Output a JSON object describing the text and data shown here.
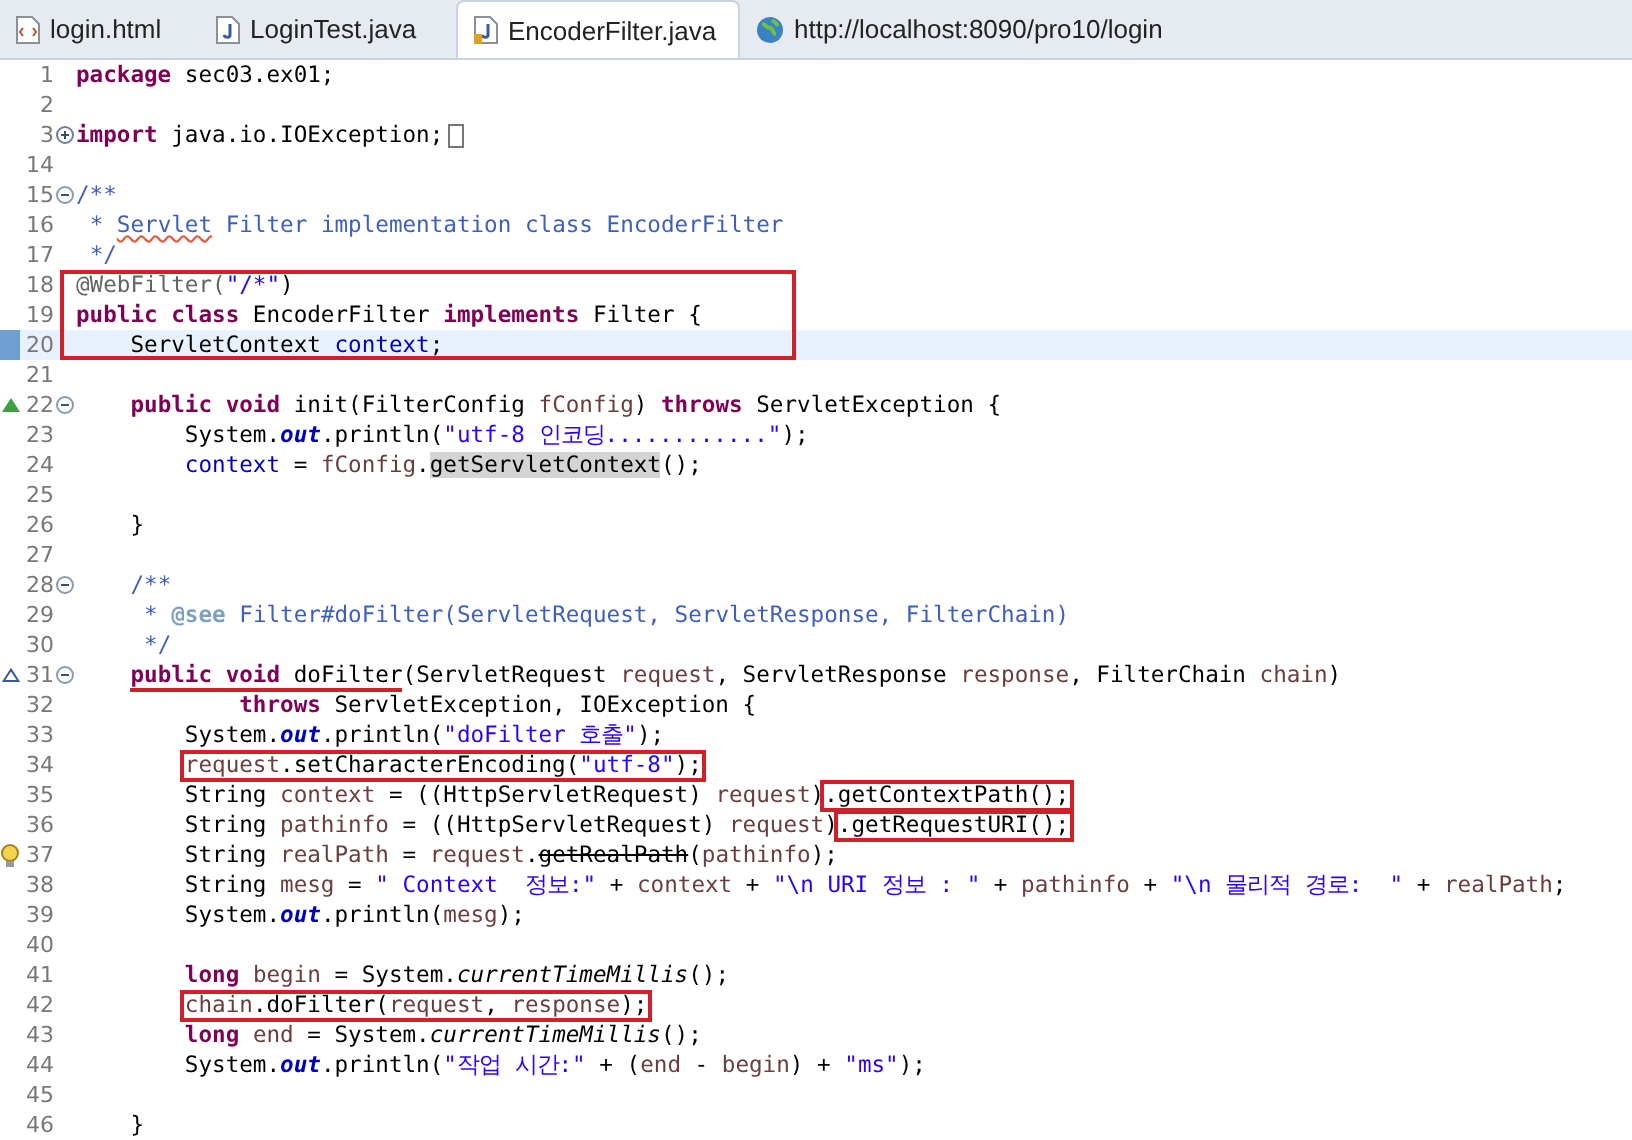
{
  "tabs": [
    {
      "label": "login.html",
      "kind": "html",
      "selected": false
    },
    {
      "label": "LoginTest.java",
      "kind": "java",
      "selected": false
    },
    {
      "label": "EncoderFilter.java",
      "kind": "java",
      "selected": true
    },
    {
      "label": "http://localhost:8090/pro10/login",
      "kind": "web",
      "selected": false
    }
  ],
  "lines": [
    {
      "kind": "line",
      "number": "1",
      "current": false,
      "tokens": [
        {
          "text": "package ",
          "kind": "keyword"
        },
        {
          "text": "sec03.ex01;",
          "kind": "plain"
        }
      ]
    },
    {
      "kind": "line",
      "number": "2",
      "current": false
    },
    {
      "kind": "line",
      "number": "3",
      "current": false,
      "folded": true,
      "tokens": [
        {
          "text": "import ",
          "kind": "keyword"
        },
        {
          "text": "java.io.IOException;",
          "kind": "plain"
        }
      ]
    },
    {
      "kind": "line",
      "number": "14",
      "current": false
    },
    {
      "kind": "line",
      "number": "15",
      "current": false,
      "folded": false,
      "tokens": [
        {
          "text": "/**",
          "kind": "comment"
        }
      ]
    },
    {
      "kind": "line",
      "number": "16",
      "current": false,
      "tokens": [
        {
          "text": " * ",
          "kind": "comment"
        },
        {
          "text": "Servlet",
          "kind": "comment",
          "misspelled": true
        },
        {
          "text": " Filter implementation class EncoderFilter",
          "kind": "comment"
        }
      ]
    },
    {
      "kind": "line",
      "number": "17",
      "current": false,
      "tokens": [
        {
          "text": " */",
          "kind": "comment"
        }
      ]
    },
    {
      "kind": "frame",
      "lines": [
        {
          "number": "18",
          "current": false,
          "tokens": [
            {
              "text": "@WebFilter(",
              "kind": "annotation"
            },
            {
              "text": "\"/*\"",
              "kind": "string"
            },
            {
              "text": ")",
              "kind": "plain"
            }
          ]
        },
        {
          "number": "19",
          "current": false,
          "tokens": [
            {
              "text": "public class ",
              "kind": "keyword"
            },
            {
              "text": "EncoderFilter ",
              "kind": "plain"
            },
            {
              "text": "implements ",
              "kind": "keyword"
            },
            {
              "text": "Filter {",
              "kind": "plain"
            }
          ]
        },
        {
          "number": "20",
          "current": true,
          "tokens": [
            {
              "text": "    ServletContext ",
              "kind": "plain"
            },
            {
              "text": "context",
              "kind": "field"
            },
            {
              "text": ";",
              "kind": "plain"
            }
          ]
        }
      ]
    },
    {
      "kind": "line",
      "number": "21",
      "current": false
    },
    {
      "kind": "override",
      "number": "22",
      "current": false,
      "folded": false,
      "tokens": [
        {
          "text": "    public void ",
          "kind": "keyword"
        },
        {
          "text": "init(FilterConfig ",
          "kind": "plain"
        },
        {
          "text": "fConfig",
          "kind": "variable"
        },
        {
          "text": ") ",
          "kind": "plain"
        },
        {
          "text": "throws ",
          "kind": "keyword"
        },
        {
          "text": "ServletException {",
          "kind": "plain"
        }
      ]
    },
    {
      "kind": "line",
      "number": "23",
      "current": false,
      "tokens": [
        {
          "text": "        System.",
          "kind": "plain"
        },
        {
          "text": "out",
          "kind": "static-field"
        },
        {
          "text": ".println(",
          "kind": "plain"
        },
        {
          "text": "\"utf-8 인코딩............\"",
          "kind": "string"
        },
        {
          "text": ");",
          "kind": "plain"
        }
      ]
    },
    {
      "kind": "line",
      "number": "24",
      "current": false,
      "tokens": [
        {
          "text": "        context",
          "kind": "field"
        },
        {
          "text": " = ",
          "kind": "plain"
        },
        {
          "text": "fConfig",
          "kind": "variable"
        },
        {
          "text": ".",
          "kind": "plain"
        },
        {
          "text": "getServletContext",
          "kind": "plain",
          "highlighted": true
        },
        {
          "text": "();",
          "kind": "plain"
        }
      ]
    },
    {
      "kind": "line",
      "number": "25",
      "current": false
    },
    {
      "kind": "line",
      "number": "26",
      "current": false,
      "tokens": [
        {
          "text": "    }",
          "kind": "plain"
        }
      ]
    },
    {
      "kind": "line",
      "number": "27",
      "current": false
    },
    {
      "kind": "line",
      "number": "28",
      "current": false,
      "folded": false,
      "tokens": [
        {
          "text": "    /**",
          "kind": "comment"
        }
      ]
    },
    {
      "kind": "line",
      "number": "29",
      "current": false,
      "tokens": [
        {
          "text": "     * ",
          "kind": "comment"
        },
        {
          "text": "@see",
          "kind": "doc-tag"
        },
        {
          "text": " Filter#doFilter(ServletRequest, ServletResponse, FilterChain)",
          "kind": "comment"
        }
      ]
    },
    {
      "kind": "line",
      "number": "30",
      "current": false,
      "tokens": [
        {
          "text": "     */",
          "kind": "comment"
        }
      ]
    },
    {
      "kind": "implements",
      "number": "31",
      "current": false,
      "folded": false,
      "tokens": [
        {
          "text": "    public void ",
          "kind": "keyword",
          "underlined": true
        },
        {
          "text": "doFilter",
          "kind": "plain",
          "underlined": true
        },
        {
          "text": "(ServletRequest ",
          "kind": "plain"
        },
        {
          "text": "request",
          "kind": "variable"
        },
        {
          "text": ", ServletResponse ",
          "kind": "plain"
        },
        {
          "text": "response",
          "kind": "variable"
        },
        {
          "text": ", FilterChain ",
          "kind": "plain"
        },
        {
          "text": "chain",
          "kind": "variable"
        },
        {
          "text": ")",
          "kind": "plain"
        }
      ]
    },
    {
      "kind": "line",
      "number": "32",
      "current": false,
      "tokens": [
        {
          "text": "            throws ",
          "kind": "keyword"
        },
        {
          "text": "ServletException, IOException {",
          "kind": "plain"
        }
      ]
    },
    {
      "kind": "line",
      "number": "33",
      "current": false,
      "tokens": [
        {
          "text": "        System.",
          "kind": "plain"
        },
        {
          "text": "out",
          "kind": "static-field"
        },
        {
          "text": ".println(",
          "kind": "plain"
        },
        {
          "text": "\"doFilter 호출\"",
          "kind": "string"
        },
        {
          "text": ");",
          "kind": "plain"
        }
      ]
    },
    {
      "kind": "line",
      "number": "34",
      "current": false,
      "tokens": [
        {
          "text": "        request",
          "kind": "variable",
          "boxed": true
        },
        {
          "text": ".setCharacterEncoding(",
          "kind": "plain",
          "boxed": true
        },
        {
          "text": "\"utf-8\"",
          "kind": "string",
          "boxed": true
        },
        {
          "text": ");",
          "kind": "plain",
          "boxed": true
        }
      ]
    },
    {
      "kind": "line",
      "number": "35",
      "current": false,
      "tokens": [
        {
          "text": "        String ",
          "kind": "plain"
        },
        {
          "text": "context",
          "kind": "variable"
        },
        {
          "text": " = ((HttpServletRequest) ",
          "kind": "plain"
        },
        {
          "text": "request",
          "kind": "variable"
        },
        {
          "text": ")",
          "kind": "plain"
        },
        {
          "text": ".getContextPath();",
          "kind": "plain",
          "boxed": true
        }
      ]
    },
    {
      "kind": "line",
      "number": "36",
      "current": false,
      "tokens": [
        {
          "text": "        String ",
          "kind": "plain"
        },
        {
          "text": "pathinfo",
          "kind": "variable"
        },
        {
          "text": " = ((HttpServletRequest) ",
          "kind": "plain"
        },
        {
          "text": "request",
          "kind": "variable"
        },
        {
          "text": ")",
          "kind": "plain"
        },
        {
          "text": ".getRequestURI();",
          "kind": "plain",
          "boxed": true
        }
      ]
    },
    {
      "kind": "warning",
      "number": "37",
      "current": false,
      "tokens": [
        {
          "text": "        String ",
          "kind": "plain"
        },
        {
          "text": "realPath",
          "kind": "variable"
        },
        {
          "text": " = ",
          "kind": "plain"
        },
        {
          "text": "request",
          "kind": "variable"
        },
        {
          "text": ".",
          "kind": "plain"
        },
        {
          "text": "getRealPath",
          "kind": "plain",
          "deprecated": true
        },
        {
          "text": "(",
          "kind": "plain"
        },
        {
          "text": "pathinfo",
          "kind": "variable"
        },
        {
          "text": ");",
          "kind": "plain"
        }
      ]
    },
    {
      "kind": "line",
      "number": "38",
      "current": false,
      "tokens": [
        {
          "text": "        String ",
          "kind": "plain"
        },
        {
          "text": "mesg",
          "kind": "variable"
        },
        {
          "text": " = ",
          "kind": "plain"
        },
        {
          "text": "\" Context  정보:\"",
          "kind": "string"
        },
        {
          "text": " + ",
          "kind": "plain"
        },
        {
          "text": "context",
          "kind": "variable"
        },
        {
          "text": " + ",
          "kind": "plain"
        },
        {
          "text": "\"\\n URI 정보 : \"",
          "kind": "string"
        },
        {
          "text": " + ",
          "kind": "plain"
        },
        {
          "text": "pathinfo",
          "kind": "variable"
        },
        {
          "text": " + ",
          "kind": "plain"
        },
        {
          "text": "\"\\n 물리적 경로:  \"",
          "kind": "string"
        },
        {
          "text": " + ",
          "kind": "plain"
        },
        {
          "text": "realPath",
          "kind": "variable"
        },
        {
          "text": ";",
          "kind": "plain"
        }
      ]
    },
    {
      "kind": "line",
      "number": "39",
      "current": false,
      "tokens": [
        {
          "text": "        System.",
          "kind": "plain"
        },
        {
          "text": "out",
          "kind": "static-field"
        },
        {
          "text": ".println(",
          "kind": "plain"
        },
        {
          "text": "mesg",
          "kind": "variable"
        },
        {
          "text": ");",
          "kind": "plain"
        }
      ]
    },
    {
      "kind": "line",
      "number": "40",
      "current": false
    },
    {
      "kind": "line",
      "number": "41",
      "current": false,
      "tokens": [
        {
          "text": "        long ",
          "kind": "keyword"
        },
        {
          "text": "begin",
          "kind": "variable"
        },
        {
          "text": " = System.",
          "kind": "plain"
        },
        {
          "text": "currentTimeMillis",
          "kind": "static-method"
        },
        {
          "text": "();",
          "kind": "plain"
        }
      ]
    },
    {
      "kind": "line",
      "number": "42",
      "current": false,
      "tokens": [
        {
          "text": "        chain",
          "kind": "variable",
          "boxed": true
        },
        {
          "text": ".doFilter(",
          "kind": "plain",
          "boxed": true
        },
        {
          "text": "request",
          "kind": "variable",
          "boxed": true
        },
        {
          "text": ", ",
          "kind": "plain",
          "boxed": true
        },
        {
          "text": "response",
          "kind": "variable",
          "boxed": true
        },
        {
          "text": ");",
          "kind": "plain",
          "boxed": true
        }
      ]
    },
    {
      "kind": "line",
      "number": "43",
      "current": false,
      "tokens": [
        {
          "text": "        long ",
          "kind": "keyword"
        },
        {
          "text": "end",
          "kind": "variable"
        },
        {
          "text": " = System.",
          "kind": "plain"
        },
        {
          "text": "currentTimeMillis",
          "kind": "static-method"
        },
        {
          "text": "();",
          "kind": "plain"
        }
      ]
    },
    {
      "kind": "line",
      "number": "44",
      "current": false,
      "tokens": [
        {
          "text": "        System.",
          "kind": "plain"
        },
        {
          "text": "out",
          "kind": "static-field"
        },
        {
          "text": ".println(",
          "kind": "plain"
        },
        {
          "text": "\"작업 시간:\"",
          "kind": "string"
        },
        {
          "text": " + (",
          "kind": "plain"
        },
        {
          "text": "end",
          "kind": "variable"
        },
        {
          "text": " - ",
          "kind": "plain"
        },
        {
          "text": "begin",
          "kind": "variable"
        },
        {
          "text": ") + ",
          "kind": "plain"
        },
        {
          "text": "\"ms\"",
          "kind": "string"
        },
        {
          "text": ");",
          "kind": "plain"
        }
      ]
    },
    {
      "kind": "line",
      "number": "45",
      "current": false
    },
    {
      "kind": "line",
      "number": "46",
      "current": false,
      "tokens": [
        {
          "text": "    }",
          "kind": "plain"
        }
      ]
    }
  ]
}
